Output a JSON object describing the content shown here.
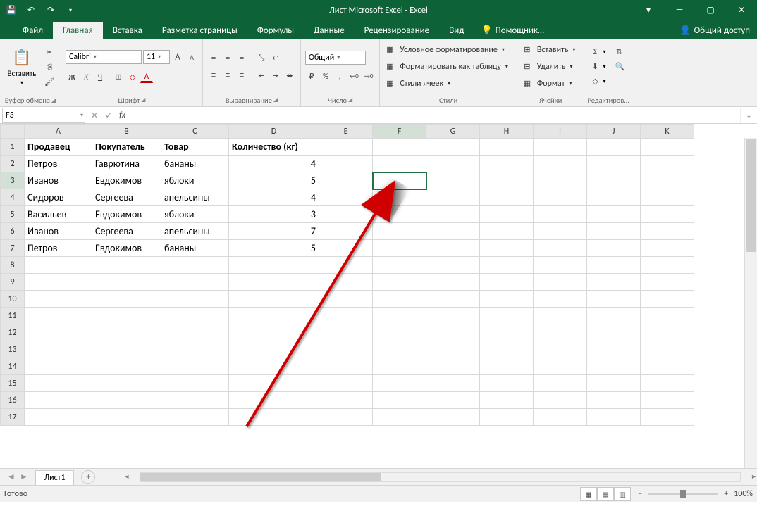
{
  "window": {
    "title": "Лист Microsoft Excel - Excel",
    "min": "—",
    "max": "▢",
    "close": "✕",
    "ribopts": "▾",
    "help": "?"
  },
  "qat": {
    "save": "💾",
    "undo": "↶",
    "redo": "↷",
    "dd": "▾"
  },
  "tabs": {
    "file": "Файл",
    "home": "Главная",
    "insert": "Вставка",
    "layout": "Разметка страницы",
    "formulas": "Формулы",
    "data": "Данные",
    "review": "Рецензирование",
    "view": "Вид",
    "tellme": "Помощник…",
    "tellme_icon": "💡",
    "share": "Общий доступ",
    "share_icon": "👤"
  },
  "clipboard": {
    "label": "Буфер обмена",
    "paste": "Вставить",
    "paste_icon": "📋",
    "cut": "✂",
    "copy": "⎘",
    "painter": "🖌"
  },
  "font": {
    "label": "Шрифт",
    "name": "Calibri",
    "size": "11",
    "grow": "A",
    "shrink": "A",
    "bold": "Ж",
    "italic": "К",
    "underline": "Ч",
    "border": "⊞",
    "fill": "◇",
    "color": "A"
  },
  "align": {
    "label": "Выравнивание",
    "top": "≡",
    "mid": "≡",
    "bot": "≡",
    "left": "≡",
    "center": "≡",
    "right": "≡",
    "deindent": "⇤",
    "indent": "⇥",
    "orient": "⤡",
    "wrap": "↩",
    "merge": "⬌"
  },
  "number": {
    "label": "Число",
    "format": "Общий",
    "currency": "₽",
    "percent": "%",
    "comma": ",",
    "incdec": "←0",
    "decdec": "→0"
  },
  "styles": {
    "label": "Стили",
    "condfmt": "Условное форматирование",
    "table": "Форматировать как таблицу",
    "cellstyles": "Стили ячеек"
  },
  "cells": {
    "label": "Ячейки",
    "insert": "Вставить",
    "delete": "Удалить",
    "format": "Формат"
  },
  "editing": {
    "label": "Редактиров…",
    "sum": "Σ",
    "fill": "⬇",
    "clear": "◇",
    "sort": "⇅",
    "find": "🔍"
  },
  "namebox": "F3",
  "fx": {
    "cancel": "✕",
    "enter": "✓",
    "fx": "fx"
  },
  "cols": [
    "A",
    "B",
    "C",
    "D",
    "E",
    "F",
    "G",
    "H",
    "I",
    "J",
    "K"
  ],
  "rows": [
    "1",
    "2",
    "3",
    "4",
    "5",
    "6",
    "7",
    "8",
    "9",
    "10",
    "11",
    "12",
    "13",
    "14",
    "15",
    "16",
    "17"
  ],
  "header": {
    "a": "Продавец",
    "b": "Покупатель",
    "c": "Товар",
    "d": "Количество (кг)"
  },
  "data": [
    {
      "a": "Петров",
      "b": "Гаврютина",
      "c": "бананы",
      "d": "4"
    },
    {
      "a": "Иванов",
      "b": "Евдокимов",
      "c": "яблоки",
      "d": "5"
    },
    {
      "a": "Сидоров",
      "b": "Сергеева",
      "c": "апельсины",
      "d": "4"
    },
    {
      "a": "Васильев",
      "b": "Евдокимов",
      "c": "яблоки",
      "d": "3"
    },
    {
      "a": "Иванов",
      "b": "Сергеева",
      "c": "апельсины",
      "d": "7"
    },
    {
      "a": "Петров",
      "b": "Евдокимов",
      "c": "бананы",
      "d": "5"
    }
  ],
  "sheet": {
    "name": "Лист1",
    "add": "+",
    "nav_l": "◄",
    "nav_r": "►"
  },
  "status": {
    "ready": "Готово",
    "zoom": "100%",
    "minus": "−",
    "plus": "+"
  }
}
